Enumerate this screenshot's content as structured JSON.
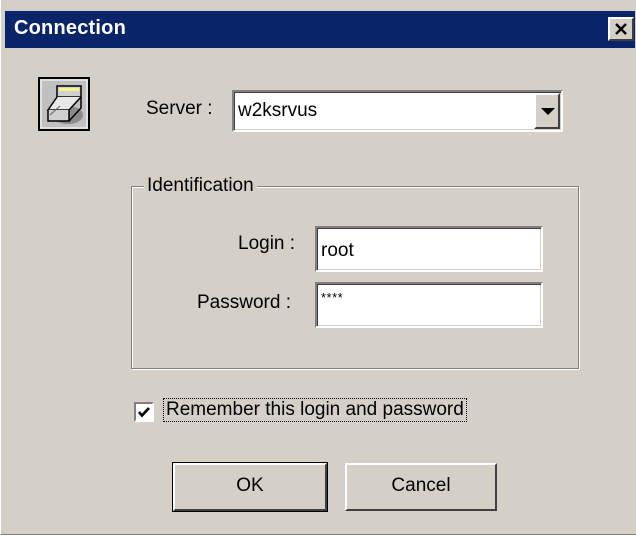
{
  "window": {
    "title": "Connection"
  },
  "server": {
    "label": "Server :",
    "value": "w2ksrvus"
  },
  "identification": {
    "legend": "Identification",
    "login_label": "Login :",
    "login_value": "root",
    "password_label": "Password :",
    "password_value": "****"
  },
  "remember": {
    "label": "Remember this login and password",
    "checked": true
  },
  "buttons": {
    "ok": "OK",
    "cancel": "Cancel"
  },
  "icons": {
    "title_close": "close-icon",
    "app": "server-connection-icon",
    "combo": "chevron-down-icon",
    "check": "checkmark-icon"
  },
  "colors": {
    "titlebar": "#0a246a",
    "face": "#d4d0c8"
  }
}
